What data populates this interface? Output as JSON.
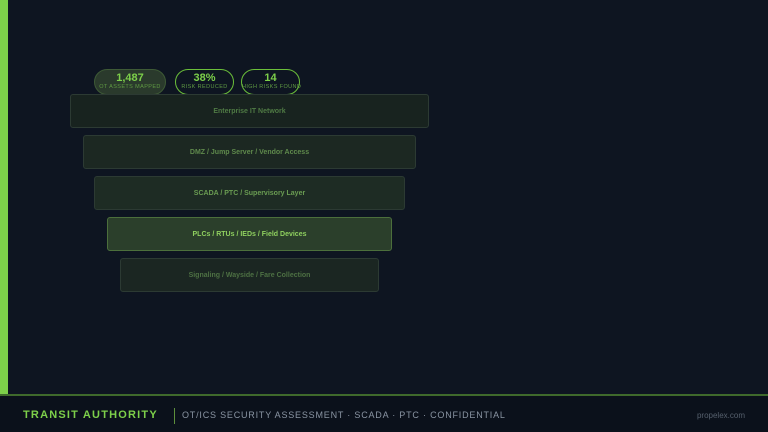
{
  "stats": [
    {
      "value": "1,487",
      "label": "OT ASSETS MAPPED"
    },
    {
      "value": "38%",
      "label": "RISK REDUCED"
    },
    {
      "value": "14",
      "label": "HIGH RISKS FOUND"
    }
  ],
  "layers": [
    "Enterprise IT Network",
    "DMZ / Jump Server / Vendor Access",
    "SCADA / PTC / Supervisory Layer",
    "PLCs / RTUs / IEDs / Field Devices",
    "Signaling / Wayside / Fare Collection"
  ],
  "footer": {
    "brand": "TRANSIT AUTHORITY",
    "subtitle": "OT/ICS SECURITY ASSESSMENT · SCADA · PTC · CONFIDENTIAL",
    "site": "propelex.com"
  },
  "colors": {
    "accent": "#7dd04a",
    "background": "#0e1521"
  }
}
